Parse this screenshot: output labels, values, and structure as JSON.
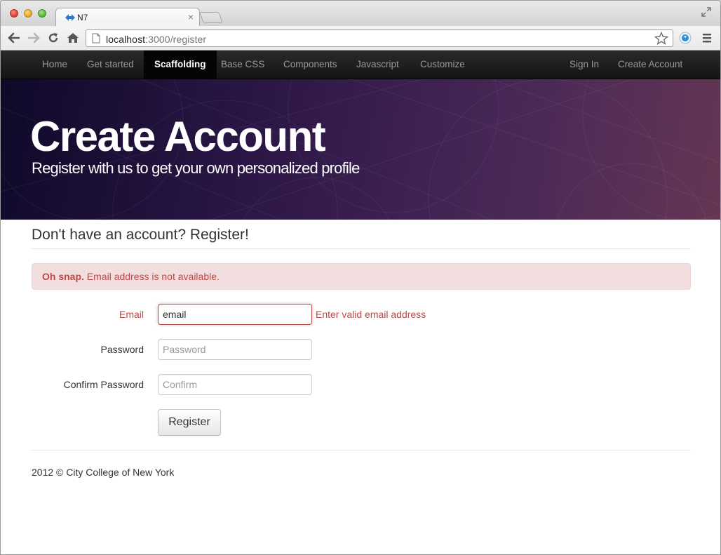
{
  "browser": {
    "tab_title": "N7",
    "tab_close": "×",
    "url_host": "localhost",
    "url_path": ":3000/register"
  },
  "navbar": {
    "left_items": [
      {
        "label": "Home",
        "active": false
      },
      {
        "label": "Get started",
        "active": false
      },
      {
        "label": "Scaffolding",
        "active": true
      },
      {
        "label": "Base CSS",
        "active": false
      },
      {
        "label": "Components",
        "active": false
      },
      {
        "label": "Javascript",
        "active": false
      },
      {
        "label": "Customize",
        "active": false
      }
    ],
    "right_items": [
      {
        "label": "Sign In"
      },
      {
        "label": "Create Account"
      }
    ]
  },
  "hero": {
    "title": "Create Account",
    "subtitle": "Register with us to get your own personalized profile"
  },
  "main": {
    "section_title": "Don't have an account? Register!",
    "alert": {
      "strong": "Oh snap.",
      "message": " Email address is not available."
    },
    "form": {
      "email_label": "Email",
      "email_value": "email",
      "email_error": "Enter valid email address",
      "password_label": "Password",
      "password_placeholder": "Password",
      "confirm_label": "Confirm Password",
      "confirm_placeholder": "Confirm",
      "submit_label": "Register"
    }
  },
  "footer": {
    "text": "2012 © City College of New York"
  },
  "colors": {
    "error": "#b94a48",
    "alert_bg": "#f2dede",
    "navbar_bg": "#1b1b1b"
  }
}
